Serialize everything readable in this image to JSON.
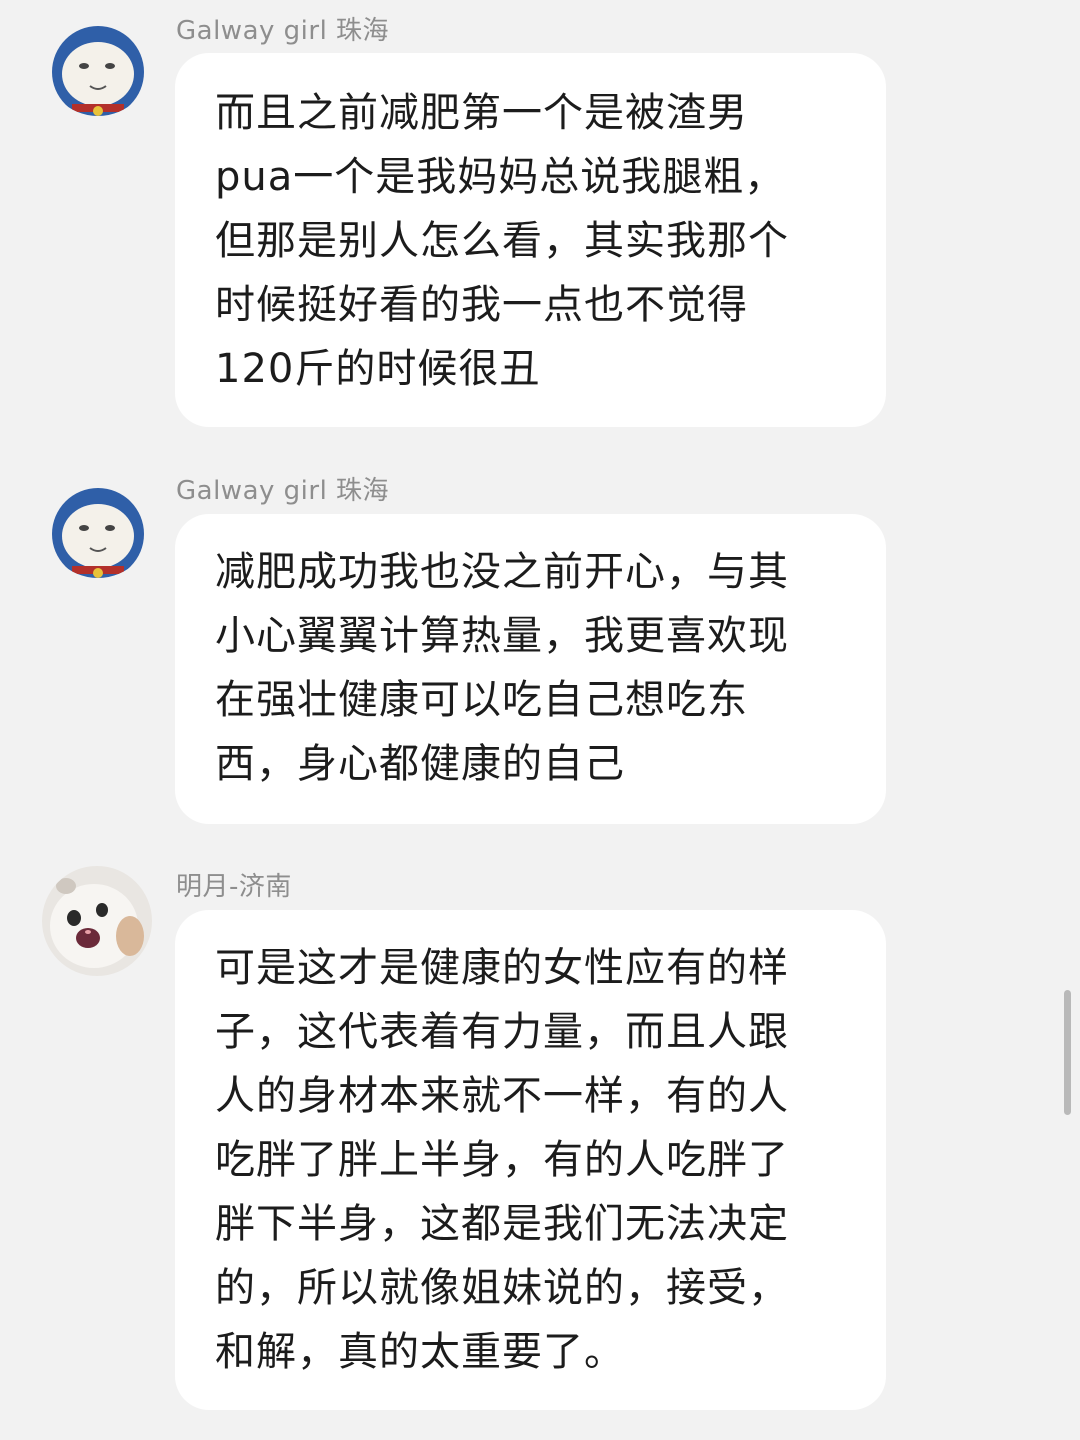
{
  "messages": [
    {
      "sender": "Galway girl 珠海",
      "avatar_icon": "doraemon-face-avatar",
      "text": "而且之前减肥第一个是被渣男\npua一个是我妈妈总说我腿粗，\n但那是别人怎么看，其实我那个\n时候挺好看的我一点也不觉得\n120斤的时候很丑"
    },
    {
      "sender": "Galway girl 珠海",
      "avatar_icon": "doraemon-face-avatar",
      "text": "减肥成功我也没之前开心，与其\n小心翼翼计算热量，我更喜欢现\n在强壮健康可以吃自己想吃东\n西，身心都健康的自己"
    },
    {
      "sender": "明月-济南",
      "avatar_icon": "white-cat-avatar",
      "text": "可是这才是健康的女性应有的样\n子，这代表着有力量，而且人跟\n人的身材本来就不一样，有的人\n吃胖了胖上半身，有的人吃胖了\n胖下半身，这都是我们无法决定\n的，所以就像姐妹说的，接受，\n和解，真的太重要了。"
    }
  ]
}
